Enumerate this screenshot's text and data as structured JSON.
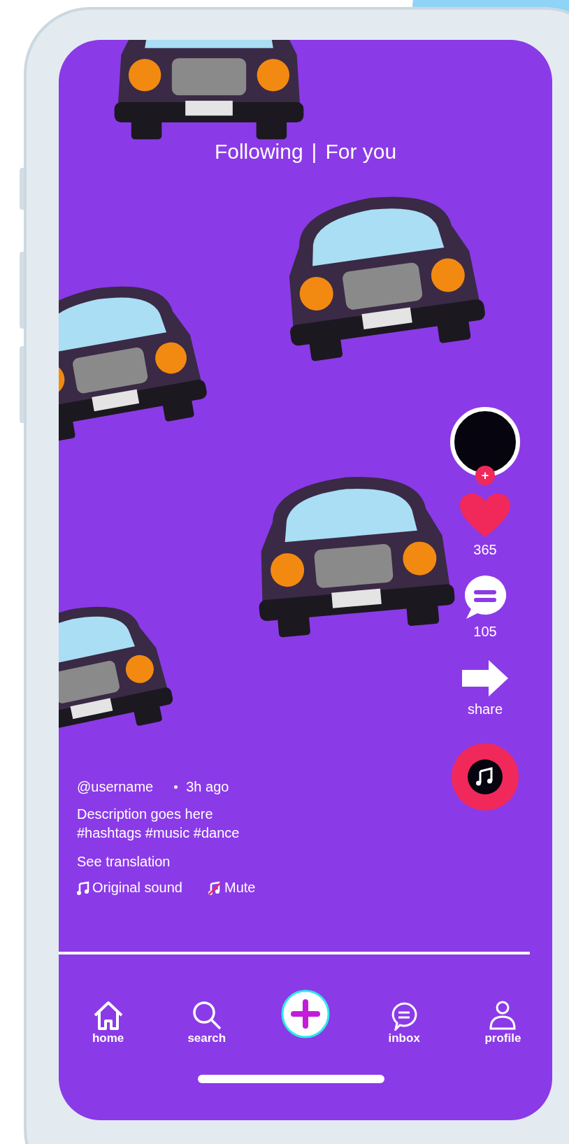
{
  "feed_tabs": [
    {
      "label": "Following"
    },
    {
      "label": "|"
    },
    {
      "label": "For you"
    }
  ],
  "creator": {
    "follow_badge": "+"
  },
  "actions": [
    {
      "kind": "like",
      "count": "365"
    },
    {
      "kind": "comment",
      "count": "105"
    },
    {
      "kind": "share",
      "count": "share"
    }
  ],
  "caption": {
    "username": "@username",
    "time": "3h ago",
    "description": "Description goes here",
    "hashtags": "#hashtags #music #dance",
    "translation_link": "See translation",
    "sound": "Original sound",
    "mute": "Mute"
  },
  "nav": [
    {
      "kind": "home",
      "label": "home"
    },
    {
      "kind": "search",
      "label": "search"
    },
    {
      "kind": "create"
    },
    {
      "kind": "inbox",
      "label": "inbox"
    },
    {
      "kind": "profile",
      "label": "profile"
    }
  ]
}
